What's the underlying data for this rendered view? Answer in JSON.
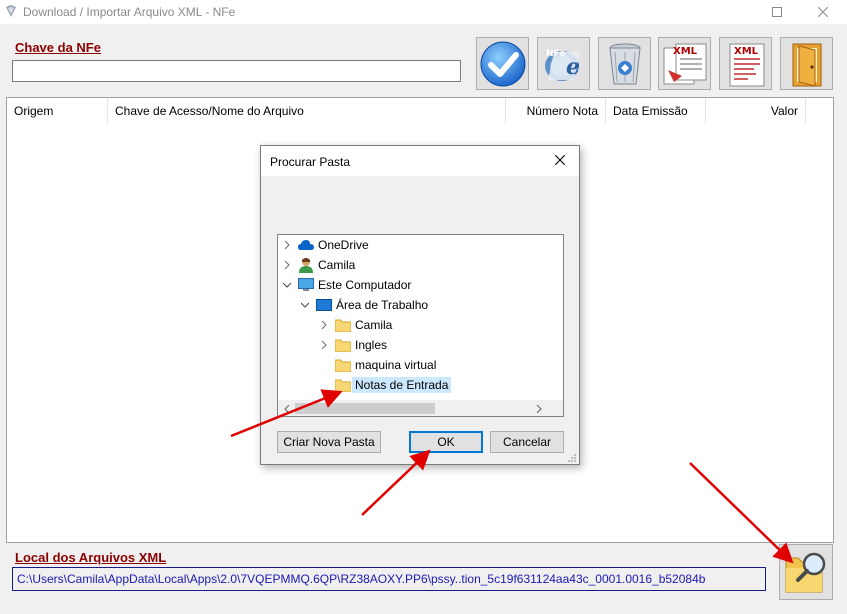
{
  "window": {
    "title": "Download / Importar Arquivo XML - NFe"
  },
  "chave": {
    "label": "Chave da NFe",
    "value": ""
  },
  "toolbar": {
    "buttons": [
      {
        "name": "confirm",
        "icon": "checkmark-icon"
      },
      {
        "name": "nfe",
        "icon": "nfe-logo-icon",
        "text": "NFe"
      },
      {
        "name": "delete",
        "icon": "recycle-bin-icon"
      },
      {
        "name": "xml-import",
        "icon": "xml-document-icon",
        "text": "XML"
      },
      {
        "name": "xml-export",
        "icon": "xml-list-icon",
        "text": "XML"
      },
      {
        "name": "exit",
        "icon": "exit-door-icon"
      }
    ]
  },
  "grid": {
    "columns": [
      {
        "label": "Origem"
      },
      {
        "label": "Chave de Acesso/Nome do Arquivo"
      },
      {
        "label": "Número Nota"
      },
      {
        "label": "Data Emissão"
      },
      {
        "label": "Valor"
      }
    ],
    "rows": []
  },
  "local": {
    "label": "Local dos Arquivos XML",
    "path": "C:\\Users\\Camila\\AppData\\Local\\Apps\\2.0\\7VQEPMMQ.6QP\\RZ38AOXY.PP6\\pssy..tion_5c19f631124aa43c_0001.0016_b52084b"
  },
  "dialog": {
    "title": "Procurar Pasta",
    "tree": [
      {
        "label": "OneDrive",
        "icon": "onedrive-cloud-icon",
        "expander": "collapsed",
        "level": 0
      },
      {
        "label": "Camila",
        "icon": "user-icon",
        "expander": "collapsed",
        "level": 0
      },
      {
        "label": "Este Computador",
        "icon": "computer-icon",
        "expander": "expanded",
        "level": 0
      },
      {
        "label": "Área de Trabalho",
        "icon": "desktop-icon",
        "expander": "expanded",
        "level": 1
      },
      {
        "label": "Camila",
        "icon": "folder-icon",
        "expander": "collapsed",
        "level": 2
      },
      {
        "label": "Ingles",
        "icon": "folder-icon",
        "expander": "collapsed",
        "level": 2
      },
      {
        "label": "maquina virtual",
        "icon": "folder-icon",
        "expander": "none",
        "level": 2
      },
      {
        "label": "Notas de Entrada",
        "icon": "folder-icon",
        "expander": "none",
        "level": 2,
        "selected": true
      }
    ],
    "buttons": {
      "new_folder": "Criar Nova Pasta",
      "ok": "OK",
      "cancel": "Cancelar"
    }
  },
  "colors": {
    "label_red": "#8b0000",
    "path_blue": "#1a1ab0",
    "selection": "#cce8ff",
    "ok_border": "#0078d7",
    "arrow": "#e00000"
  }
}
